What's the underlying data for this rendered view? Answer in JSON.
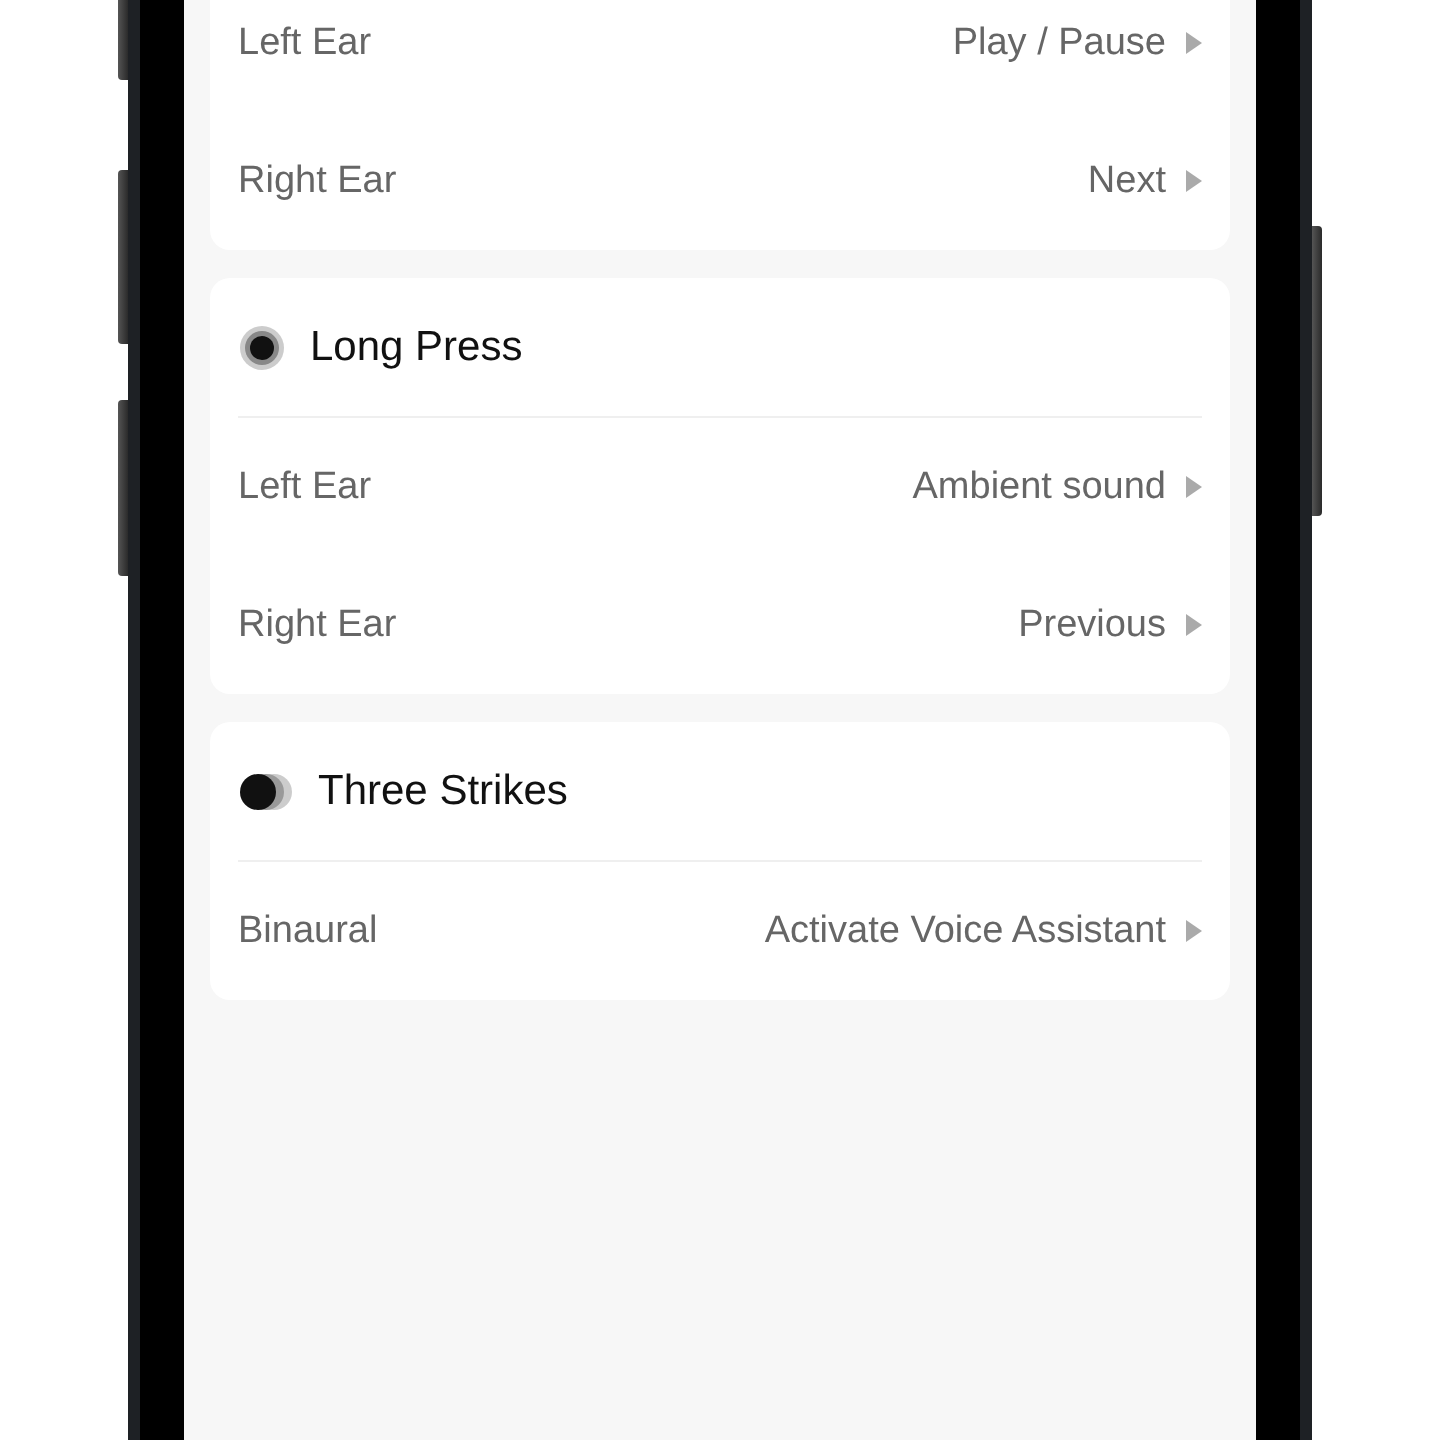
{
  "sections": [
    {
      "rows": [
        {
          "label": "Left Ear",
          "value": "Play / Pause"
        },
        {
          "label": "Right Ear",
          "value": "Next"
        }
      ]
    },
    {
      "title": "Long Press",
      "kind": "long_press",
      "rows": [
        {
          "label": "Left Ear",
          "value": "Ambient sound"
        },
        {
          "label": "Right Ear",
          "value": "Previous"
        }
      ]
    },
    {
      "title": "Three Strikes",
      "kind": "three_strikes",
      "rows": [
        {
          "label": "Binaural",
          "value": "Activate Voice Assistant"
        }
      ]
    }
  ]
}
